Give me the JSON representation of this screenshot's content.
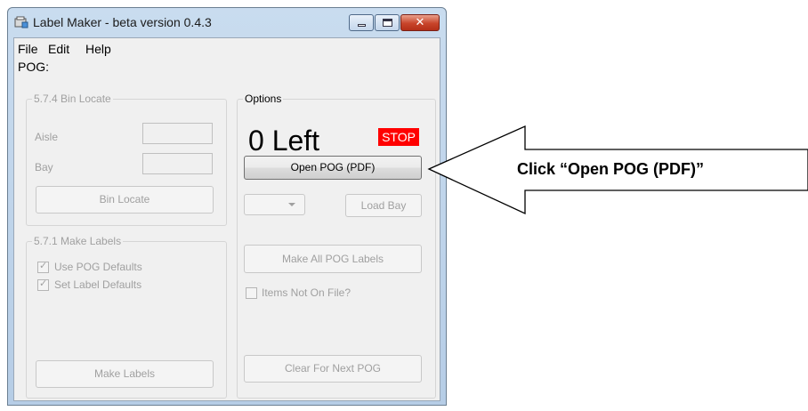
{
  "window": {
    "title": "Label Maker - beta version 0.4.3",
    "close_glyph": "✕"
  },
  "menu": {
    "items": [
      "File",
      "Edit",
      "Help"
    ]
  },
  "pog_label": "POG:",
  "bin_locate": {
    "group_title": "5.7.4 Bin Locate",
    "aisle_label": "Aisle",
    "bay_label": "Bay",
    "button_label": "Bin Locate"
  },
  "make_labels": {
    "group_title": "5.7.1 Make Labels",
    "use_pog_defaults": {
      "label": "Use POG Defaults",
      "checked": true
    },
    "set_label_defaults": {
      "label": "Set Label Defaults",
      "checked": true
    },
    "button_label": "Make Labels"
  },
  "options": {
    "group_title": "Options",
    "left_count": "0 Left",
    "stop_label": "STOP",
    "open_pog_label": "Open POG (PDF)",
    "load_bay_label": "Load Bay",
    "make_all_label": "Make All POG Labels",
    "items_not_on_file": {
      "label": "Items Not On File?",
      "checked": false
    },
    "clear_label": "Clear For Next POG"
  },
  "annotation": {
    "text": "Click “Open POG (PDF)”"
  },
  "colors": {
    "stop_bg": "#ff0000",
    "disabled_text": "#a0a0a0",
    "window_frame": "#c9dcef"
  }
}
